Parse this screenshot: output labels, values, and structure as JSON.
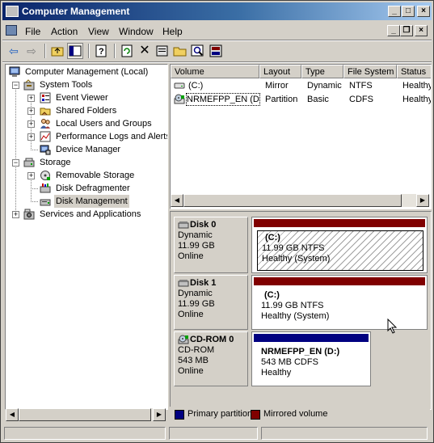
{
  "window": {
    "title": "Computer Management"
  },
  "menu": {
    "items": [
      {
        "label": "File",
        "accel": "F"
      },
      {
        "label": "Action",
        "accel": "A"
      },
      {
        "label": "View",
        "accel": "V"
      },
      {
        "label": "Window",
        "accel": "W"
      },
      {
        "label": "Help",
        "accel": "H"
      }
    ]
  },
  "tree": {
    "root": "Computer Management (Local)",
    "system_tools": "System Tools",
    "event_viewer": "Event Viewer",
    "shared_folders": "Shared Folders",
    "local_users": "Local Users and Groups",
    "perf_logs": "Performance Logs and Alerts",
    "device_manager": "Device Manager",
    "storage": "Storage",
    "removable_storage": "Removable Storage",
    "disk_defrag": "Disk Defragmenter",
    "disk_management": "Disk Management",
    "services_apps": "Services and Applications"
  },
  "volume_list": {
    "columns": [
      "Volume",
      "Layout",
      "Type",
      "File System",
      "Status"
    ],
    "rows": [
      [
        "(C:)",
        "Mirror",
        "Dynamic",
        "NTFS",
        "Healthy"
      ],
      [
        "NRMEFPP_EN (D:)",
        "Partition",
        "Basic",
        "CDFS",
        "Healthy"
      ]
    ]
  },
  "disks": [
    {
      "name": "Disk 0",
      "type": "Dynamic",
      "size": "11.99 GB",
      "state": "Online",
      "partition": {
        "name": "(C:)",
        "detail": "11.99 GB NTFS",
        "status": "Healthy (System)"
      }
    },
    {
      "name": "Disk 1",
      "type": "Dynamic",
      "size": "11.99 GB",
      "state": "Online",
      "partition": {
        "name": "(C:)",
        "detail": "11.99 GB NTFS",
        "status": "Healthy (System)"
      }
    },
    {
      "name": "CD-ROM 0",
      "type": "CD-ROM",
      "size": "543 MB",
      "state": "Online",
      "partition": {
        "name": "NRMEFPP_EN  (D:)",
        "detail": "543 MB CDFS",
        "status": "Healthy"
      }
    }
  ],
  "legend": {
    "primary": "Primary partition",
    "mirrored": "Mirrored volume"
  },
  "colors": {
    "mirrored": "#800000",
    "primary": "#000080",
    "title_start": "#0a246a",
    "title_end": "#a6caf0"
  }
}
